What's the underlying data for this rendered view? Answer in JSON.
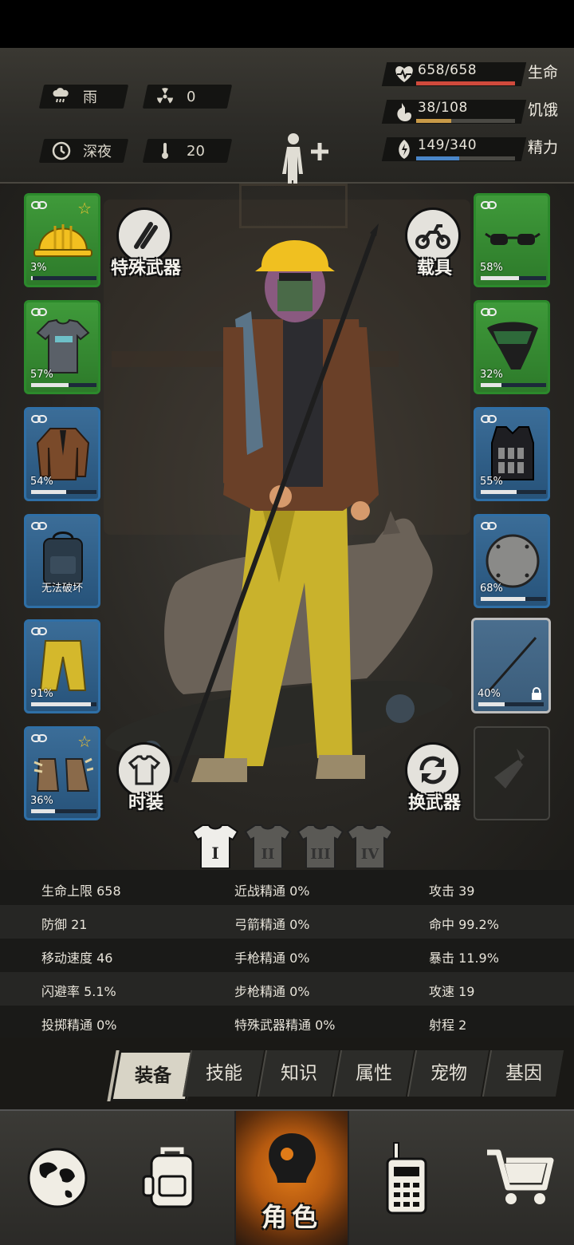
{
  "environment": {
    "weather": "雨",
    "radiation": "0",
    "time_of_day": "深夜",
    "temperature": "20"
  },
  "vitals": [
    {
      "icon": "heart-icon",
      "value": "658/658",
      "label": "生命",
      "fraction": 1.0,
      "color": "#d04a3c"
    },
    {
      "icon": "stomach-icon",
      "value": "38/108",
      "label": "饥饿",
      "fraction": 0.352,
      "color": "#c89a48"
    },
    {
      "icon": "energy-icon",
      "value": "149/340",
      "label": "精力",
      "fraction": 0.438,
      "color": "#4a86c8"
    }
  ],
  "equipment": {
    "left": [
      {
        "slot": "head",
        "item_icon": "hard-hat-icon",
        "durability": "3%",
        "fraction": 0.03,
        "rarity": "green",
        "starred": true
      },
      {
        "slot": "shirt",
        "item_icon": "tshirt-icon",
        "durability": "57%",
        "fraction": 0.57,
        "rarity": "green",
        "starred": false
      },
      {
        "slot": "jacket",
        "item_icon": "leather-jacket-icon",
        "durability": "54%",
        "fraction": 0.54,
        "rarity": "blue",
        "starred": false
      },
      {
        "slot": "backpack",
        "item_icon": "backpack-icon",
        "durability": "无法破坏",
        "fraction": null,
        "rarity": "blue",
        "starred": false
      },
      {
        "slot": "pants",
        "item_icon": "pants-icon",
        "durability": "91%",
        "fraction": 0.91,
        "rarity": "blue",
        "starred": false
      },
      {
        "slot": "shoes",
        "item_icon": "shoes-icon",
        "durability": "36%",
        "fraction": 0.36,
        "rarity": "blue",
        "starred": true
      }
    ],
    "right": [
      {
        "slot": "eyewear",
        "item_icon": "glasses-icon",
        "durability": "58%",
        "fraction": 0.58,
        "rarity": "green"
      },
      {
        "slot": "mask",
        "item_icon": "mask-icon",
        "durability": "32%",
        "fraction": 0.32,
        "rarity": "green"
      },
      {
        "slot": "vest",
        "item_icon": "vest-icon",
        "durability": "55%",
        "fraction": 0.55,
        "rarity": "blue"
      },
      {
        "slot": "shield",
        "item_icon": "shield-icon",
        "durability": "68%",
        "fraction": 0.68,
        "rarity": "blue"
      },
      {
        "slot": "weapon",
        "item_icon": "spear-icon",
        "durability": "40%",
        "fraction": 0.4,
        "rarity": "grey",
        "locked": true
      },
      {
        "slot": "secondary",
        "item_icon": "bottle-icon",
        "durability": "",
        "fraction": null,
        "rarity": "empty"
      }
    ]
  },
  "buttons": {
    "special_weapon": "特殊武器",
    "vehicle": "载具",
    "fashion": "时装",
    "swap_weapon": "换武器"
  },
  "outfit_sets": [
    "I",
    "II",
    "III",
    "IV"
  ],
  "attributes": [
    [
      "生命上限 658",
      "近战精通 0%",
      "攻击 39"
    ],
    [
      "防御 21",
      "弓箭精通 0%",
      "命中 99.2%"
    ],
    [
      "移动速度 46",
      "手枪精通 0%",
      "暴击 11.9%"
    ],
    [
      "闪避率 5.1%",
      "步枪精通 0%",
      "攻速 19"
    ],
    [
      "投掷精通 0%",
      "特殊武器精通 0%",
      "射程 2"
    ]
  ],
  "tabs": [
    "装备",
    "技能",
    "知识",
    "属性",
    "宠物",
    "基因"
  ],
  "nav": [
    {
      "icon": "globe-icon",
      "label": ""
    },
    {
      "icon": "backpack-icon",
      "label": ""
    },
    {
      "icon": "character-icon",
      "label": "角色"
    },
    {
      "icon": "radio-icon",
      "label": ""
    },
    {
      "icon": "cart-icon",
      "label": ""
    }
  ]
}
